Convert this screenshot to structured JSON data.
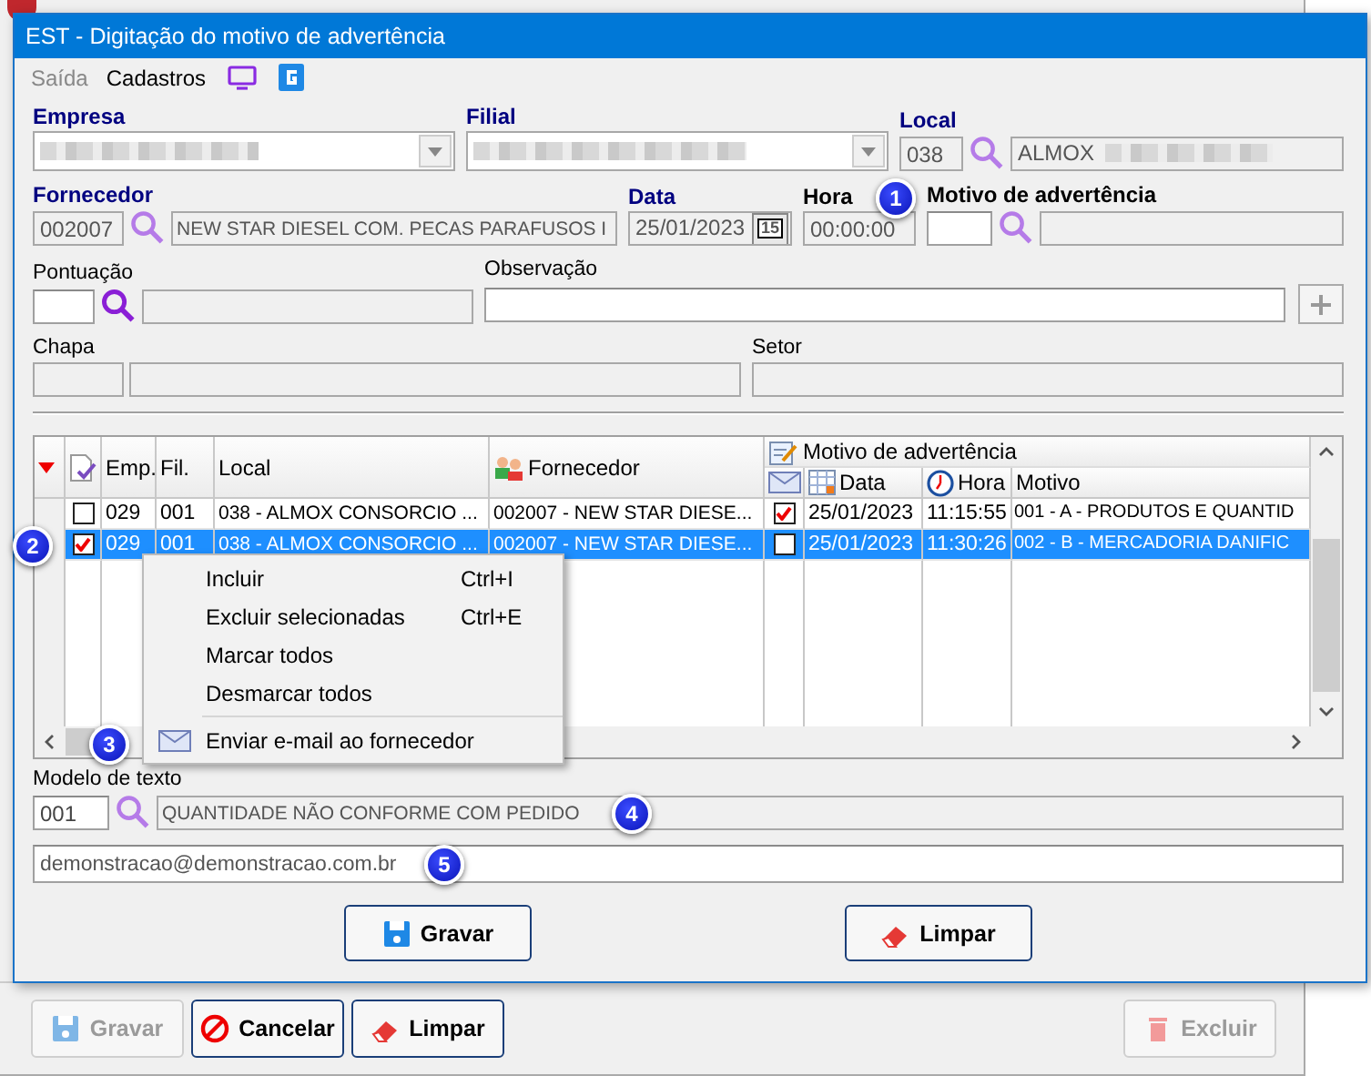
{
  "window": {
    "title": "EST - Digitação do motivo de advertência"
  },
  "menu": [
    {
      "label": "Saída",
      "disabled": true
    },
    {
      "label": "Cadastros",
      "disabled": false
    }
  ],
  "empresa": {
    "label": "Empresa",
    "kind": "required"
  },
  "filial": {
    "label": "Filial",
    "kind": "required"
  },
  "local": {
    "label": "Local",
    "kind": "required",
    "code": "038",
    "name": "ALMOX"
  },
  "fornecedor": {
    "label": "Fornecedor",
    "kind": "required",
    "code": "002007",
    "name": "NEW STAR DIESEL COM. PECAS PARAFUSOS I"
  },
  "data": {
    "label": "Data",
    "kind": "required",
    "value": "25/01/2023",
    "calendar_day": "15"
  },
  "hora": {
    "label": "Hora",
    "kind": "bold",
    "value": "00:00:00",
    "callout": "1"
  },
  "motivo": {
    "label": "Motivo de advertência",
    "kind": "bold"
  },
  "pontuacao": {
    "label": "Pontuação",
    "kind": "plain"
  },
  "observacao": {
    "label": "Observação",
    "kind": "plain"
  },
  "chapa": {
    "label": "Chapa",
    "kind": "plain"
  },
  "setor": {
    "label": "Setor",
    "kind": "plain"
  },
  "grid": {
    "columns": [
      "Emp.",
      "Fil.",
      "Local",
      "Fornecedor"
    ],
    "group": "Motivo de advertência",
    "group_columns": [
      "Data",
      "Hora",
      "Motivo"
    ],
    "rows": [
      {
        "checked": false,
        "selected": false,
        "email_sent": true,
        "cells": [
          "029",
          "001",
          "038 - ALMOX CONSORCIO ...",
          "002007 - NEW STAR DIESE...",
          "25/01/2023",
          "11:15:55",
          "001 - A - PRODUTOS E QUANTID"
        ]
      },
      {
        "checked": true,
        "selected": true,
        "email_sent": false,
        "callout": "2",
        "cells": [
          "029",
          "001",
          "038 - ALMOX CONSORCIO ...",
          "002007 - NEW STAR DIESE...",
          "25/01/2023",
          "11:30:26",
          "002 - B - MERCADORIA DANIFIC"
        ]
      }
    ]
  },
  "context_menu": [
    {
      "kind": "item",
      "label": "Incluir",
      "shortcut": "Ctrl+I"
    },
    {
      "kind": "item",
      "label": "Excluir selecionadas",
      "shortcut": "Ctrl+E"
    },
    {
      "kind": "item",
      "label": "Marcar todos"
    },
    {
      "kind": "item",
      "label": "Desmarcar todos"
    },
    {
      "kind": "separator"
    },
    {
      "kind": "mail",
      "label": "Enviar e-mail ao fornecedor",
      "callout": "3"
    }
  ],
  "modelo": {
    "label": "Modelo de texto",
    "kind": "plain",
    "code": "001",
    "name": "QUANTIDADE NÃO CONFORME COM PEDIDO",
    "callout": "4"
  },
  "email": {
    "value": "demonstracao@demonstracao.com.br",
    "callout": "5"
  },
  "buttons": [
    {
      "label": "Gravar",
      "disabled": false
    },
    {
      "label": "Limpar",
      "disabled": false
    }
  ],
  "background_toolbar": [
    {
      "label": "Gravar",
      "disabled": true
    },
    {
      "label": "Cancelar",
      "disabled": false
    },
    {
      "label": "Limpar",
      "disabled": false
    },
    {
      "label": "Excluir",
      "disabled": true
    }
  ]
}
